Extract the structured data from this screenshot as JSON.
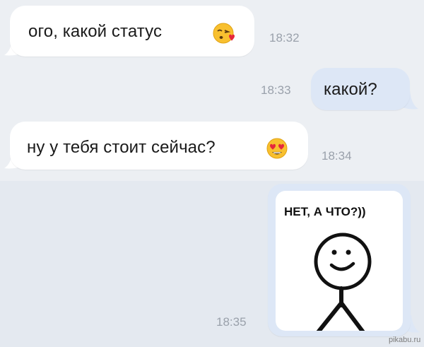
{
  "conversation": {
    "messages": [
      {
        "direction": "incoming",
        "text": "ого, какой статус",
        "emoji": "kissing-heart-emoji",
        "time": "18:32"
      },
      {
        "direction": "outgoing",
        "text": "какой?",
        "time": "18:33"
      },
      {
        "direction": "incoming",
        "text": "ну у тебя стоит сейчас?",
        "emoji": "heart-eyes-emoji",
        "time": "18:34"
      },
      {
        "direction": "outgoing",
        "type": "image",
        "image_caption": "НЕТ, А ЧТО?))",
        "image_icon": "stick-figure-meme",
        "time": "18:35"
      }
    ]
  },
  "watermark": "pikabu.ru",
  "colors": {
    "background_top": "#eceff3",
    "background_bottom": "#e4e9f0",
    "incoming_bubble": "#ffffff",
    "outgoing_bubble": "#dde7f6",
    "time_text": "#9aa1ab"
  }
}
